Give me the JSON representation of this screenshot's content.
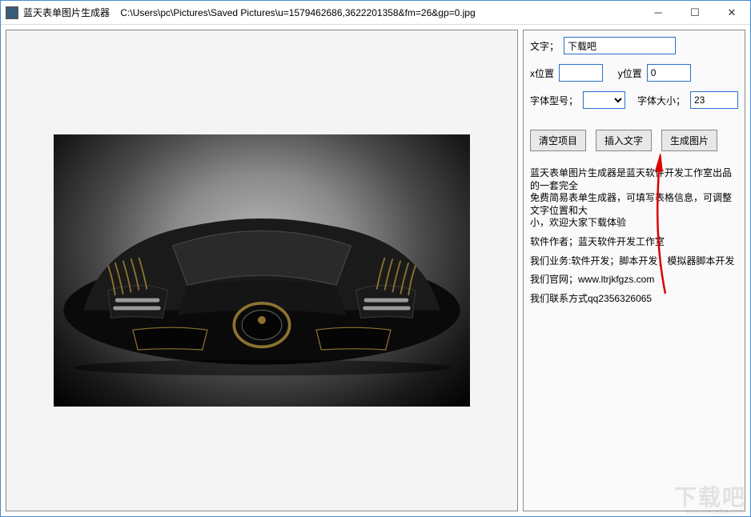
{
  "titlebar": {
    "app_name": "蓝天表单图片生成器",
    "file_path": "C:\\Users\\pc\\Pictures\\Saved Pictures\\u=1579462686,3622201358&fm=26&gp=0.jpg"
  },
  "form": {
    "text_label": "文字；",
    "text_value": "下载吧",
    "xpos_label": "x位置",
    "xpos_value": "",
    "ypos_label": "y位置",
    "ypos_value": "0",
    "font_label": "字体型号；",
    "font_value": "",
    "fontsize_label": "字体大小；",
    "fontsize_value": "23"
  },
  "buttons": {
    "clear": "清空项目",
    "insert": "插入文字",
    "generate": "生成图片"
  },
  "info": {
    "line1": "蓝天表单图片生成器是蓝天软件开发工作室出品的一套完全",
    "line2": "免费简易表单生成器，可填写表格信息，可调整文字位置和大",
    "line3": "小，欢迎大家下载体验",
    "author": "软件作者；蓝天软件开发工作室",
    "business": "我们业务:软件开发；脚本开发；模拟器脚本开发",
    "website": "我们官网；www.ltrjkfgzs.com",
    "contact": "我们联系方式qq2356326065"
  },
  "watermark": {
    "main": "下载吧",
    "sub": "www.xiazaiba.com"
  }
}
